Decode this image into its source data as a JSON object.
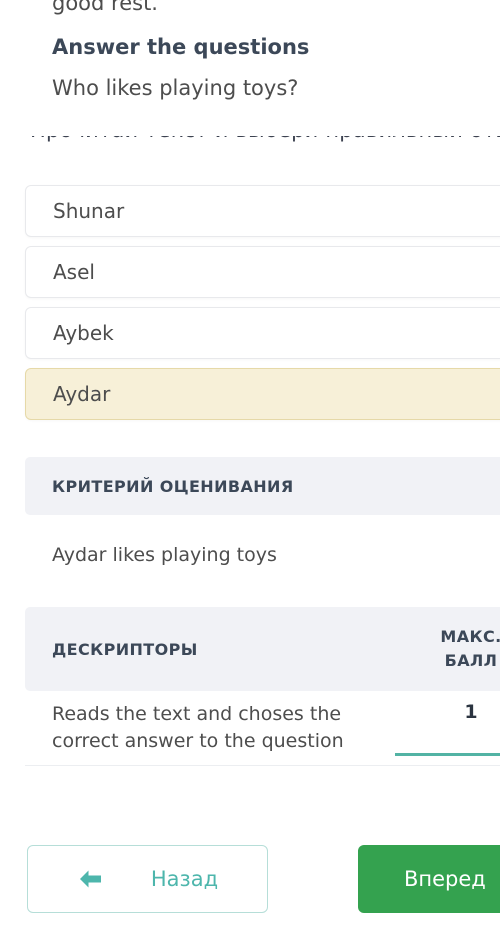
{
  "reading": {
    "passage_tail": "good rest.",
    "section_heading": "Answer the questions",
    "question": "Who likes playing toys?",
    "clipped_line": "Прочитай текст и выбери правильный ответ на вопрос"
  },
  "options": [
    {
      "label": "Shunar",
      "selected": false
    },
    {
      "label": "Asel",
      "selected": false
    },
    {
      "label": "Aybek",
      "selected": false
    },
    {
      "label": "Aydar",
      "selected": true
    }
  ],
  "criteria": {
    "header": "КРИТЕРИЙ ОЦЕНИВАНИЯ",
    "body": "Aydar likes playing toys"
  },
  "descriptors": {
    "header_label": "ДЕСКРИПТОРЫ",
    "header_score_line1": "МАКС.",
    "header_score_line2": "БАЛЛ",
    "rows": [
      {
        "text": "Reads the text and choses the correct answer to the question",
        "score": "1"
      }
    ]
  },
  "footer": {
    "back_label": "Назад",
    "back_icon": "arrow-left-icon",
    "forward_label": "Вперед"
  },
  "colors": {
    "accent_green": "#34a24f",
    "accent_teal": "#4db6ac",
    "score_rule": "#52b3a4",
    "selected_option_bg": "#f7f0d8",
    "selected_option_border": "#e6d9a8",
    "band_bg": "#f1f2f6",
    "heading_text": "#3c4858",
    "body_text": "#4d4d4d"
  }
}
